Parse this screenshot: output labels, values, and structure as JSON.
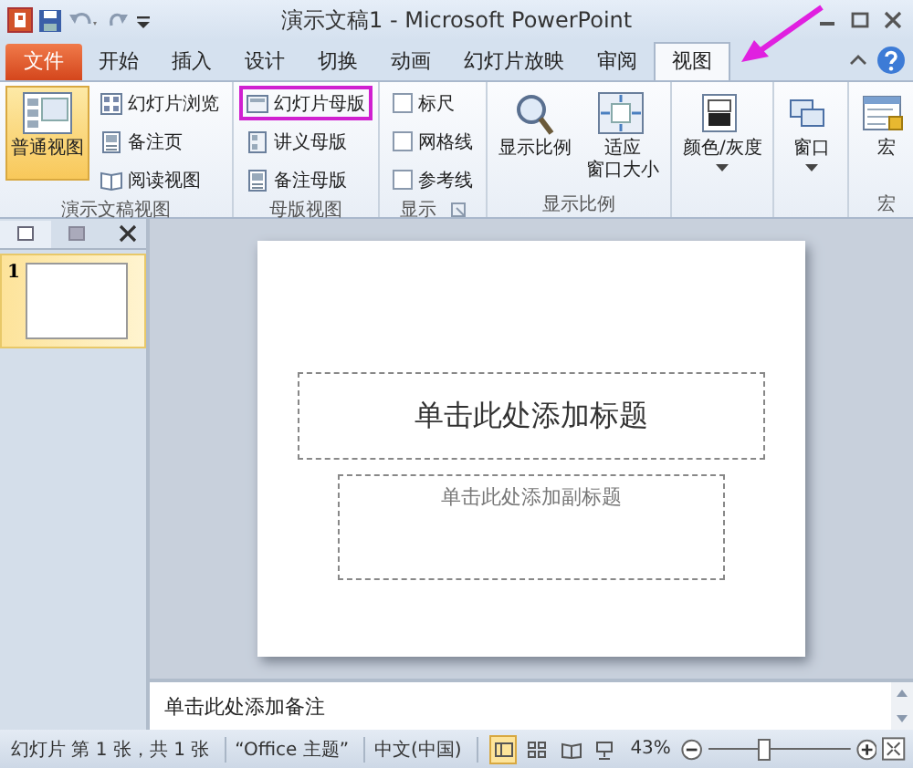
{
  "window": {
    "title": "演示文稿1 - Microsoft PowerPoint"
  },
  "tabs": [
    {
      "label": "文件",
      "kind": "file",
      "selected": false
    },
    {
      "label": "开始",
      "kind": "tab",
      "selected": false
    },
    {
      "label": "插入",
      "kind": "tab",
      "selected": false
    },
    {
      "label": "设计",
      "kind": "tab",
      "selected": false
    },
    {
      "label": "切换",
      "kind": "tab",
      "selected": false
    },
    {
      "label": "动画",
      "kind": "tab",
      "selected": false
    },
    {
      "label": "幻灯片放映",
      "kind": "tab",
      "selected": false
    },
    {
      "label": "审阅",
      "kind": "tab",
      "selected": false
    },
    {
      "label": "视图",
      "kind": "tab",
      "selected": true
    }
  ],
  "ribbon_groups": [
    {
      "label": "演示文稿视图",
      "items": [
        {
          "kind": "large",
          "label": "普通视图",
          "selected": true,
          "dropdown": false
        },
        {
          "kind": "small",
          "label": "幻灯片浏览",
          "highlighted": false
        },
        {
          "kind": "small",
          "label": "备注页",
          "highlighted": false
        },
        {
          "kind": "small",
          "label": "阅读视图",
          "highlighted": false
        }
      ]
    },
    {
      "label": "母版视图",
      "items": [
        {
          "kind": "small",
          "label": "幻灯片母版",
          "highlighted": true
        },
        {
          "kind": "small",
          "label": "讲义母版",
          "highlighted": false
        },
        {
          "kind": "small",
          "label": "备注母版",
          "highlighted": false
        }
      ]
    },
    {
      "label": "显示",
      "launcher": true,
      "items": [
        {
          "kind": "check",
          "label": "标尺",
          "checked": false
        },
        {
          "kind": "check",
          "label": "网格线",
          "checked": false
        },
        {
          "kind": "check",
          "label": "参考线",
          "checked": false
        }
      ]
    },
    {
      "label": "显示比例",
      "items": [
        {
          "kind": "large",
          "label": "显示比例",
          "selected": false,
          "dropdown": false
        },
        {
          "kind": "large",
          "lines": [
            "适应",
            "窗口大小"
          ],
          "selected": false,
          "dropdown": false
        }
      ]
    },
    {
      "items": [
        {
          "kind": "large",
          "label": "颜色/灰度",
          "selected": false,
          "dropdown": true
        }
      ]
    },
    {
      "items": [
        {
          "kind": "large",
          "label": "窗口",
          "selected": false,
          "dropdown": true
        }
      ]
    },
    {
      "label": "宏",
      "items": [
        {
          "kind": "large",
          "label": "宏",
          "selected": false,
          "dropdown": false
        }
      ]
    }
  ],
  "thumbnails": [
    {
      "number": "1",
      "selected": true
    }
  ],
  "slide": {
    "title": "单击此处添加标题",
    "subtitle": "单击此处添加副标题"
  },
  "notes": {
    "placeholder": "单击此处添加备注"
  },
  "status_bar": {
    "slide_info": "幻灯片 第 1 张，共 1 张",
    "theme": "“Office 主题”",
    "language": "中文(中国)",
    "views": [
      {
        "selected": true
      },
      {
        "selected": false
      },
      {
        "selected": false
      },
      {
        "selected": false
      }
    ],
    "zoom": "43%",
    "zoom_slider": {
      "level": 0.37
    }
  }
}
